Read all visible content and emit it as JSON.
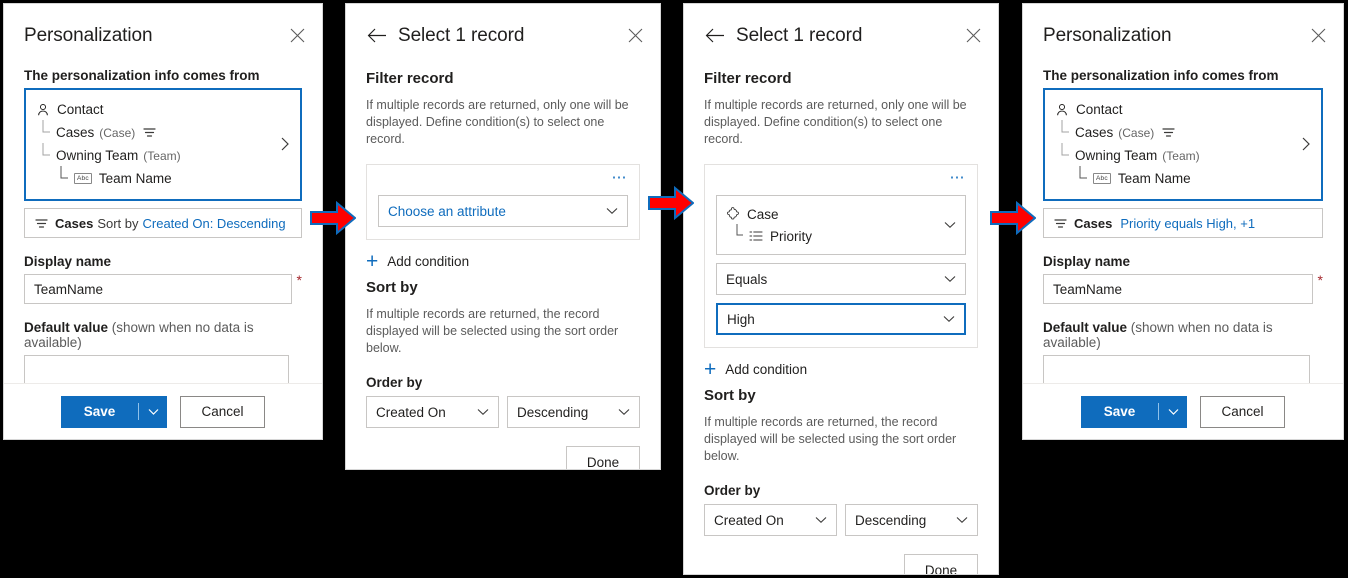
{
  "panels": {
    "personalization_1": {
      "title": "Personalization",
      "close_icon": "close-icon",
      "source_label": "The personalization info comes from",
      "tree": [
        {
          "icon": "contact-person-icon",
          "label": "Contact",
          "paren": "",
          "elbow": "",
          "filter_glyph": false,
          "indent": 0
        },
        {
          "icon": "",
          "label": "Cases",
          "paren": "(Case)",
          "elbow": "├",
          "filter_glyph": true,
          "indent": 1
        },
        {
          "icon": "",
          "label": "Owning Team",
          "paren": "(Team)",
          "elbow": "└",
          "filter_glyph": false,
          "indent": 1
        },
        {
          "icon": "abc-text-icon",
          "label": "Team Name",
          "paren": "",
          "elbow": "└",
          "filter_glyph": false,
          "indent": 2
        }
      ],
      "tree_chevron_icon": "chevron-right-icon",
      "filter_summary": {
        "icon": "filter-icon",
        "entity": "Cases",
        "middle": "Sort by",
        "link": "Created On: Descending"
      },
      "display_name_label": "Display name",
      "display_name_value": "TeamName",
      "required_marker": "*",
      "default_value_label": "Default value",
      "default_value_hint": "(shown when no data is available)",
      "default_value_value": "",
      "save_label": "Save",
      "save_chevron_icon": "chevron-down-icon",
      "cancel_label": "Cancel"
    },
    "select_record_1": {
      "back_icon": "back-arrow-icon",
      "title": "Select 1 record",
      "close_icon": "close-icon",
      "filter_heading": "Filter record",
      "filter_desc": "If multiple records are returned, only one will be displayed. Define condition(s) to select one record.",
      "overflow_icon": "ellipsis-icon",
      "attribute_dropdown": "Choose an attribute",
      "attribute_chevron_icon": "chevron-down-icon",
      "add_condition_label": "Add condition",
      "add_condition_icon": "plus-icon",
      "sort_heading": "Sort by",
      "sort_desc": "If multiple records are returned, the record displayed will be selected using the sort order below.",
      "order_by_label": "Order by",
      "order_field": "Created On",
      "order_direction": "Descending",
      "done_label": "Done"
    },
    "select_record_2": {
      "back_icon": "back-arrow-icon",
      "title": "Select 1 record",
      "close_icon": "close-icon",
      "filter_heading": "Filter record",
      "filter_desc": "If multiple records are returned, only one will be displayed. Define condition(s) to select one record.",
      "overflow_icon": "ellipsis-icon",
      "attribute_entity": "Case",
      "attribute_entity_icon": "entity-puzzle-icon",
      "attribute_field": "Priority",
      "attribute_field_icon": "optionset-list-icon",
      "attribute_chevron_icon": "chevron-down-icon",
      "operator_value": "Equals",
      "value_value": "High",
      "add_condition_label": "Add condition",
      "add_condition_icon": "plus-icon",
      "sort_heading": "Sort by",
      "sort_desc": "If multiple records are returned, the record displayed will be selected using the sort order below.",
      "order_by_label": "Order by",
      "order_field": "Created On",
      "order_direction": "Descending",
      "done_label": "Done"
    },
    "personalization_2": {
      "title": "Personalization",
      "close_icon": "close-icon",
      "source_label": "The personalization info comes from",
      "tree": [
        {
          "icon": "contact-person-icon",
          "label": "Contact",
          "paren": "",
          "elbow": "",
          "filter_glyph": false,
          "indent": 0
        },
        {
          "icon": "",
          "label": "Cases",
          "paren": "(Case)",
          "elbow": "├",
          "filter_glyph": true,
          "indent": 1
        },
        {
          "icon": "",
          "label": "Owning Team",
          "paren": "(Team)",
          "elbow": "└",
          "filter_glyph": false,
          "indent": 1
        },
        {
          "icon": "abc-text-icon",
          "label": "Team Name",
          "paren": "",
          "elbow": "└",
          "filter_glyph": false,
          "indent": 2
        }
      ],
      "tree_chevron_icon": "chevron-right-icon",
      "filter_summary": {
        "icon": "filter-icon",
        "entity": "Cases",
        "middle": "",
        "link": "Priority equals High, +1"
      },
      "display_name_label": "Display name",
      "display_name_value": "TeamName",
      "required_marker": "*",
      "default_value_label": "Default value",
      "default_value_hint": "(shown when no data is available)",
      "default_value_value": "",
      "save_label": "Save",
      "save_chevron_icon": "chevron-down-icon",
      "cancel_label": "Cancel"
    }
  },
  "annotations": {
    "arrows": [
      {
        "name": "flow-arrow-1",
        "fill": "#ff0000",
        "stroke": "#0f6cbd"
      },
      {
        "name": "flow-arrow-2",
        "fill": "#ff0000",
        "stroke": "#0f6cbd"
      },
      {
        "name": "flow-arrow-3",
        "fill": "#ff0000",
        "stroke": "#0f6cbd"
      }
    ]
  },
  "colors": {
    "accent": "#0f6cbd",
    "background": "#000000",
    "panel": "#ffffff",
    "border": "#c8c6c4",
    "required": "#a4262c",
    "muted_text": "#5b5b5b",
    "arrow_fill": "#ff0000"
  }
}
